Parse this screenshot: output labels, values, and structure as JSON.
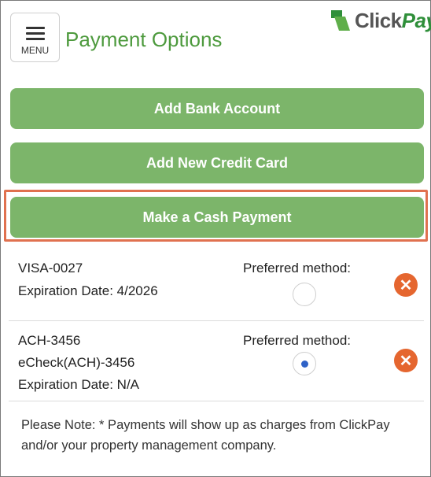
{
  "header": {
    "menu_label": "MENU",
    "title": "Payment Options",
    "logo": {
      "click": "Click",
      "pay": "Pay"
    }
  },
  "actions": {
    "add_bank": "Add Bank Account",
    "add_card": "Add New Credit Card",
    "cash_payment": "Make a Cash Payment"
  },
  "methods": [
    {
      "lines": [
        "VISA-0027",
        "Expiration Date: 4/2026"
      ],
      "preferred_label": "Preferred method:",
      "preferred": false
    },
    {
      "lines": [
        "ACH-3456",
        "eCheck(ACH)-3456",
        "Expiration Date: N/A"
      ],
      "preferred_label": "Preferred method:",
      "preferred": true
    }
  ],
  "note": "Please Note: * Payments will show up as charges from ClickPay and/or your property management company.",
  "colors": {
    "accent_green": "#7cb56a",
    "title_green": "#4d9a3d",
    "highlight": "#e0714f",
    "remove": "#e5662f",
    "radio_selected": "#2f62c7"
  },
  "icons": [
    "menu-icon",
    "clickpay-logo-icon",
    "remove-icon",
    "radio-icon"
  ]
}
